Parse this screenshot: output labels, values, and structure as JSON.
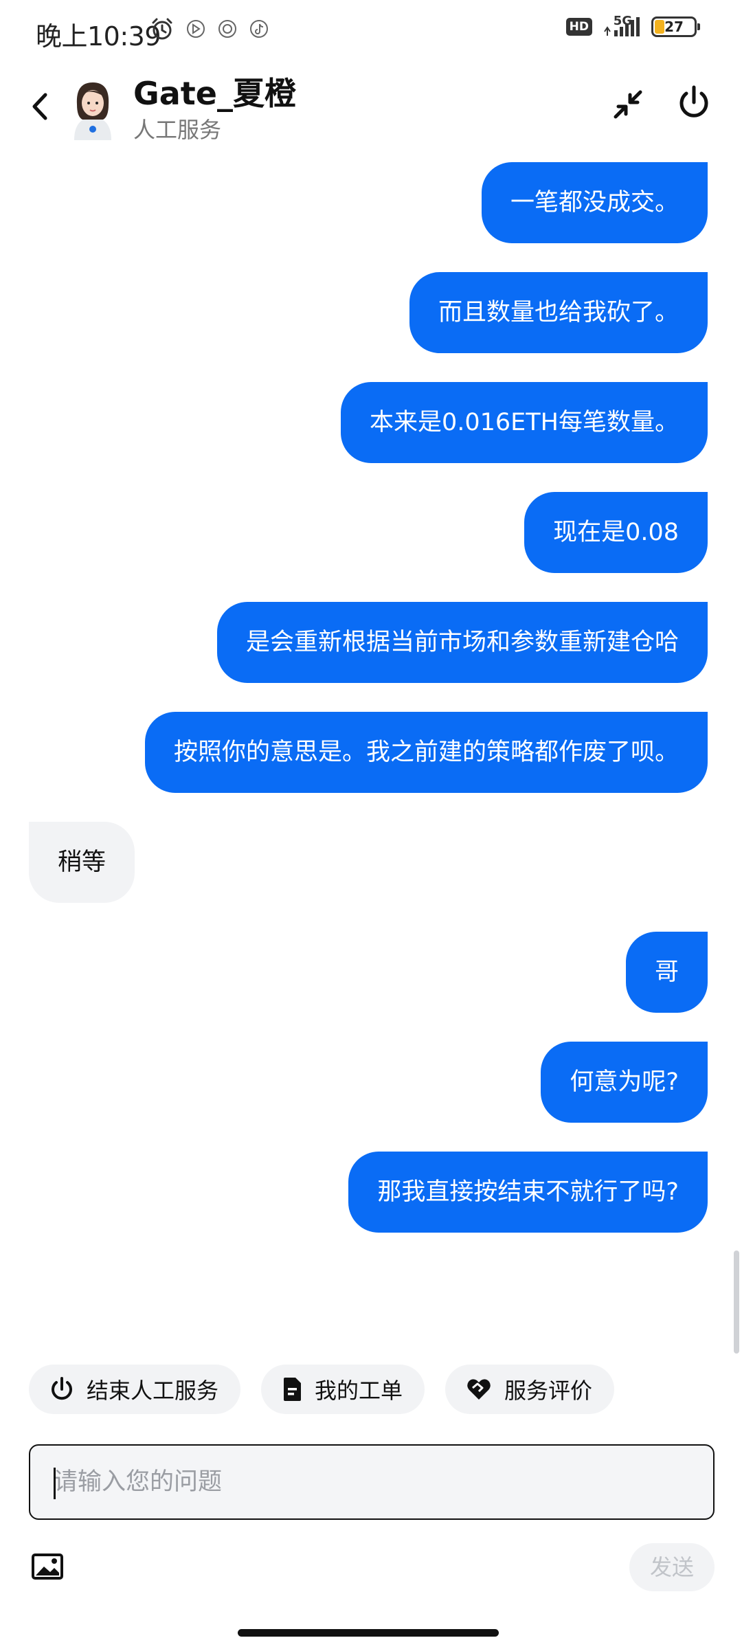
{
  "status_bar": {
    "time": "晚上10:39",
    "left_icons": [
      "alarm-icon",
      "notification-icon",
      "app-icon",
      "tiktok-icon"
    ],
    "hd_badge": "HD",
    "network": "5G",
    "battery_level": "27"
  },
  "header": {
    "agent_name": "Gate_夏橙",
    "agent_status": "人工服务",
    "icons": [
      "back-icon",
      "minimize-icon",
      "power-icon"
    ]
  },
  "messages": [
    {
      "from": "user",
      "text": "一笔都没成交。"
    },
    {
      "from": "user",
      "text": "而且数量也给我砍了。"
    },
    {
      "from": "user",
      "text": "本来是0.016ETH每笔数量。"
    },
    {
      "from": "user",
      "text": "现在是0.08"
    },
    {
      "from": "user",
      "text": "是会重新根据当前市场和参数重新建仓哈"
    },
    {
      "from": "user",
      "text": "按照你的意思是。我之前建的策略都作废了呗。"
    },
    {
      "from": "agent",
      "text": "稍等"
    },
    {
      "from": "user",
      "text": "哥"
    },
    {
      "from": "user",
      "text": "何意为呢?"
    },
    {
      "from": "user",
      "text": "那我直接按结束不就行了吗?"
    }
  ],
  "quick_actions": [
    {
      "label": "结束人工服务",
      "icon": "power-icon"
    },
    {
      "label": "我的工单",
      "icon": "document-icon"
    },
    {
      "label": "服务评价",
      "icon": "heart-handshake-icon"
    }
  ],
  "input": {
    "placeholder": "请输入您的问题",
    "value": ""
  },
  "send_label": "发送",
  "colors": {
    "user_bubble": "#0a6cf5",
    "agent_bubble": "#f2f3f5",
    "chip_bg": "#f2f3f5"
  }
}
